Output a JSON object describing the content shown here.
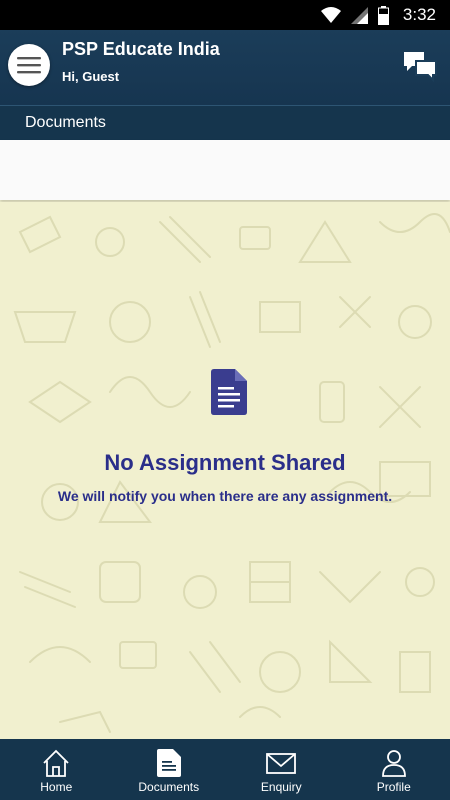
{
  "status_bar": {
    "time": "3:32"
  },
  "header": {
    "title": "PSP Educate India",
    "subtitle": "Hi, Guest"
  },
  "section": {
    "title": "Documents"
  },
  "empty_state": {
    "title": "No Assignment Shared",
    "message": "We will notify you when there are any assignment."
  },
  "bottom_nav": {
    "items": [
      {
        "label": "Home",
        "icon": "home-icon"
      },
      {
        "label": "Documents",
        "icon": "document-icon"
      },
      {
        "label": "Enquiry",
        "icon": "envelope-icon"
      },
      {
        "label": "Profile",
        "icon": "person-icon"
      }
    ]
  },
  "colors": {
    "header_bg": "#1b3d59",
    "content_bg": "#f1f0cf",
    "accent_text": "#2a2e8a",
    "doc_icon": "#3a3d8f"
  }
}
